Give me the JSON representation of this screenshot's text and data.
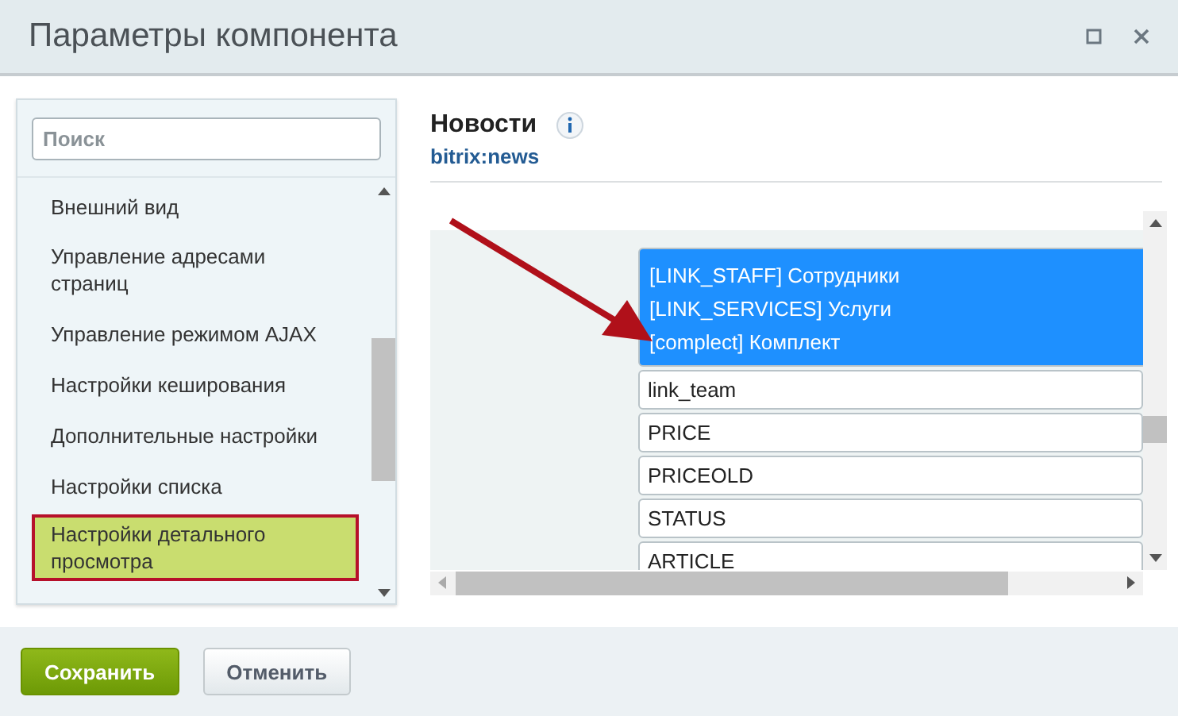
{
  "window": {
    "title": "Параметры компонента"
  },
  "sidebar": {
    "search": {
      "placeholder": "Поиск"
    },
    "items": [
      {
        "label": "Внешний вид",
        "selected": false
      },
      {
        "label": "Управление адресами страниц",
        "selected": false
      },
      {
        "label": "Управление режимом AJAX",
        "selected": false
      },
      {
        "label": "Настройки кеширования",
        "selected": false
      },
      {
        "label": "Дополнительные настройки",
        "selected": false
      },
      {
        "label": "Настройки списка",
        "selected": false
      },
      {
        "label": "Настройки детального просмотра",
        "selected": true
      }
    ]
  },
  "component": {
    "title": "Новости",
    "code": "bitrix:news"
  },
  "properties": {
    "options": [
      {
        "label": "[LINK_STAFF] Сотрудники",
        "selected": true
      },
      {
        "label": "[LINK_SERVICES] Услуги",
        "selected": true
      },
      {
        "label": "[complect] Комплект",
        "selected": true
      }
    ],
    "fields": [
      "link_team",
      "PRICE",
      "PRICEOLD",
      "STATUS",
      "ARTICLE"
    ]
  },
  "buttons": [
    {
      "label": "Сохранить",
      "kind": "primary"
    },
    {
      "label": "Отменить",
      "kind": "secondary"
    }
  ]
}
